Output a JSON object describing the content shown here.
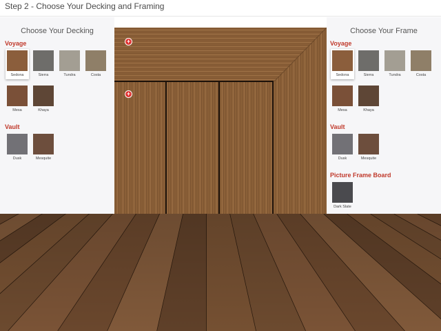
{
  "header": {
    "title": "Step 2 - Choose Your Decking and Framing"
  },
  "decking": {
    "title": "Choose Your Decking",
    "groups": [
      {
        "label": "Voyage",
        "items": [
          {
            "name": "Sedona",
            "color": "#8b5e3c",
            "selected": true
          },
          {
            "name": "Sierra",
            "color": "#6e6d6a",
            "selected": false
          },
          {
            "name": "Tundra",
            "color": "#a39e93",
            "selected": false
          },
          {
            "name": "Costa",
            "color": "#8f7f68",
            "selected": false
          },
          {
            "name": "Mesa",
            "color": "#7a5038",
            "selected": false
          },
          {
            "name": "Khaya",
            "color": "#5e4636",
            "selected": false
          }
        ]
      },
      {
        "label": "Vault",
        "items": [
          {
            "name": "Dusk",
            "color": "#727176",
            "selected": false
          },
          {
            "name": "Mesquite",
            "color": "#6d4e3d",
            "selected": false
          }
        ]
      }
    ]
  },
  "frame": {
    "title": "Choose Your Frame",
    "groups": [
      {
        "label": "Voyage",
        "items": [
          {
            "name": "Sedona",
            "color": "#8b5e3c",
            "selected": true
          },
          {
            "name": "Sierra",
            "color": "#6e6d6a",
            "selected": false
          },
          {
            "name": "Tundra",
            "color": "#a39e93",
            "selected": false
          },
          {
            "name": "Costa",
            "color": "#8f7f68",
            "selected": false
          },
          {
            "name": "Mesa",
            "color": "#7a5038",
            "selected": false
          },
          {
            "name": "Khaya",
            "color": "#5e4636",
            "selected": false
          }
        ]
      },
      {
        "label": "Vault",
        "items": [
          {
            "name": "Dusk",
            "color": "#727176",
            "selected": false
          },
          {
            "name": "Mesquite",
            "color": "#6d4e3d",
            "selected": false
          }
        ]
      },
      {
        "label": "Picture Frame Board",
        "items": [
          {
            "name": "Dark Slate",
            "color": "#4a4a4e",
            "selected": false
          }
        ]
      }
    ]
  },
  "preview": {
    "plus_icon": "plus-icon",
    "plus_glyph": "+"
  },
  "colors": {
    "accent": "#c0392b",
    "wood": "#8a6036",
    "floor": "#6b4a30"
  }
}
